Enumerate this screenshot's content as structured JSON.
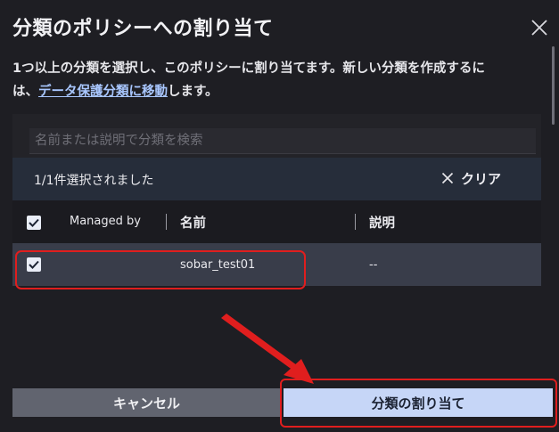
{
  "dialog": {
    "title": "分類のポリシーへの割り当て",
    "description_line1": "1つ以上の分類を選択し、このポリシーに割り当てます。新しい分類を作成するに",
    "description_line2_prefix": "は、",
    "description_link": "データ保護分類に移動",
    "description_line2_suffix": "します。"
  },
  "search": {
    "placeholder": "名前または説明で分類を検索",
    "value": ""
  },
  "selection": {
    "status": "1/1件選択されました",
    "clear_label": "クリア"
  },
  "table": {
    "columns": [
      "Managed by",
      "名前",
      "説明"
    ],
    "header_checked": true,
    "rows": [
      {
        "checked": true,
        "managed_by": "",
        "name": "sobar_test01",
        "description": "--"
      }
    ]
  },
  "footer": {
    "cancel_label": "キャンセル",
    "assign_label": "分類の割り当て"
  },
  "colors": {
    "background": "#1e1e23",
    "selection_bar": "#262d3a",
    "row_selected": "#393d4a",
    "primary_button": "#c6d6f7",
    "secondary_button": "#61646f",
    "link": "#a9c7ff",
    "annotation_red": "#e01e1e"
  }
}
